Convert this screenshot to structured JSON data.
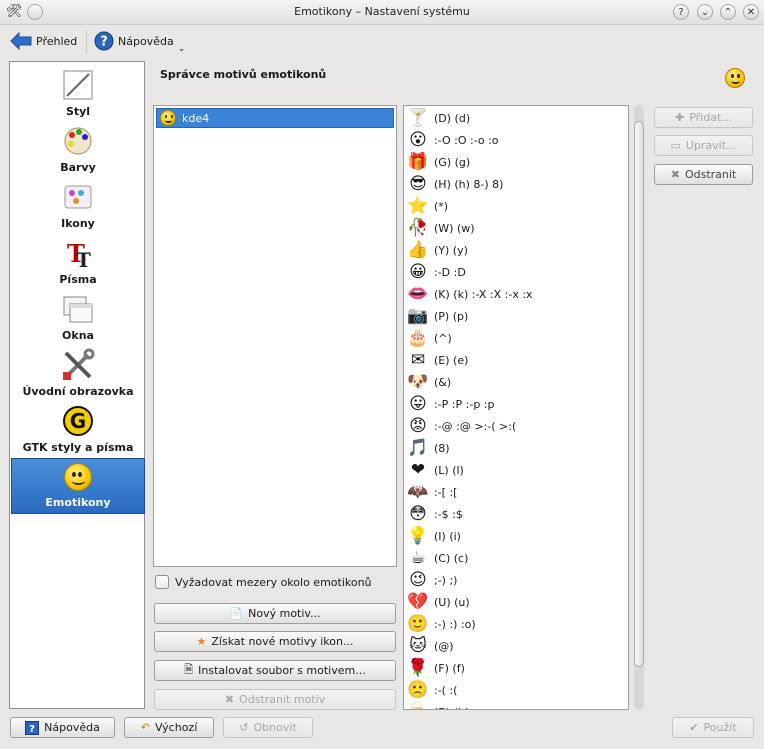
{
  "window": {
    "title": "Emotikony – Nastavení systému"
  },
  "toolbar": {
    "back_label": "Přehled",
    "help_label": "Nápověda"
  },
  "sidebar": {
    "items": [
      {
        "label": "Styl",
        "icon": "brush-icon"
      },
      {
        "label": "Barvy",
        "icon": "palette-icon"
      },
      {
        "label": "Ikony",
        "icon": "icons-icon"
      },
      {
        "label": "Písma",
        "icon": "font-icon"
      },
      {
        "label": "Okna",
        "icon": "windows-icon"
      },
      {
        "label": "Úvodní obrazovka",
        "icon": "tools-icon"
      },
      {
        "label": "GTK styly a písma",
        "icon": "gtk-icon"
      },
      {
        "label": "Emotikony",
        "icon": "smiley-icon"
      }
    ],
    "selected": "Emotikony"
  },
  "main": {
    "heading": "Správce motivů emotikonů",
    "themes": [
      {
        "name": "kde4"
      }
    ],
    "require_spaces_label": "Vyžadovat mezery okolo emotikonů",
    "buttons": {
      "new_theme": "Nový motiv...",
      "get_new": "Získat nové motivy ikon...",
      "install_file": "Instalovat soubor s motivem...",
      "remove_theme": "Odstranit motiv"
    }
  },
  "emoticons": [
    {
      "text": "(D) (d)",
      "icon": "🍸"
    },
    {
      "text": ":-O :O :-o :o",
      "icon": "😮"
    },
    {
      "text": "(G) (g)",
      "icon": "🎁"
    },
    {
      "text": "(H) (h) 8-) 8)",
      "icon": "😎"
    },
    {
      "text": "(*)",
      "icon": "⭐"
    },
    {
      "text": "(W) (w)",
      "icon": "🥀"
    },
    {
      "text": "(Y) (y)",
      "icon": "👍"
    },
    {
      "text": ":-D :D",
      "icon": "😀"
    },
    {
      "text": "(K) (k) :-X :X :-x :x",
      "icon": "👄"
    },
    {
      "text": "(P) (p)",
      "icon": "📷"
    },
    {
      "text": "(^)",
      "icon": "🎂"
    },
    {
      "text": "(E) (e)",
      "icon": "✉"
    },
    {
      "text": "(&)",
      "icon": "🐶"
    },
    {
      "text": ":-P :P :-p :p",
      "icon": "😛"
    },
    {
      "text": ":-@ :@ >:-( >:(",
      "icon": "😡"
    },
    {
      "text": "(8)",
      "icon": "🎵"
    },
    {
      "text": "(L) (l)",
      "icon": "❤"
    },
    {
      "text": ":-[ :[",
      "icon": "🦇"
    },
    {
      "text": ":-$ :$",
      "icon": "😳"
    },
    {
      "text": "(I) (i)",
      "icon": "💡"
    },
    {
      "text": "(C) (c)",
      "icon": "☕"
    },
    {
      "text": ";-) ;)",
      "icon": "😉"
    },
    {
      "text": "(U) (u)",
      "icon": "💔"
    },
    {
      "text": ":-) :) :o)",
      "icon": "🙂"
    },
    {
      "text": "(@)",
      "icon": "🐱"
    },
    {
      "text": "(F) (f)",
      "icon": "🌹"
    },
    {
      "text": ":-( :(",
      "icon": "🙁"
    },
    {
      "text": "(B) (b)",
      "icon": "🍺"
    }
  ],
  "side_buttons": {
    "add": "Přidat...",
    "edit": "Upravit...",
    "remove": "Odstranit"
  },
  "footer": {
    "help": "Nápověda",
    "defaults": "Výchozí",
    "reset": "Obnovit",
    "apply": "Použít"
  }
}
